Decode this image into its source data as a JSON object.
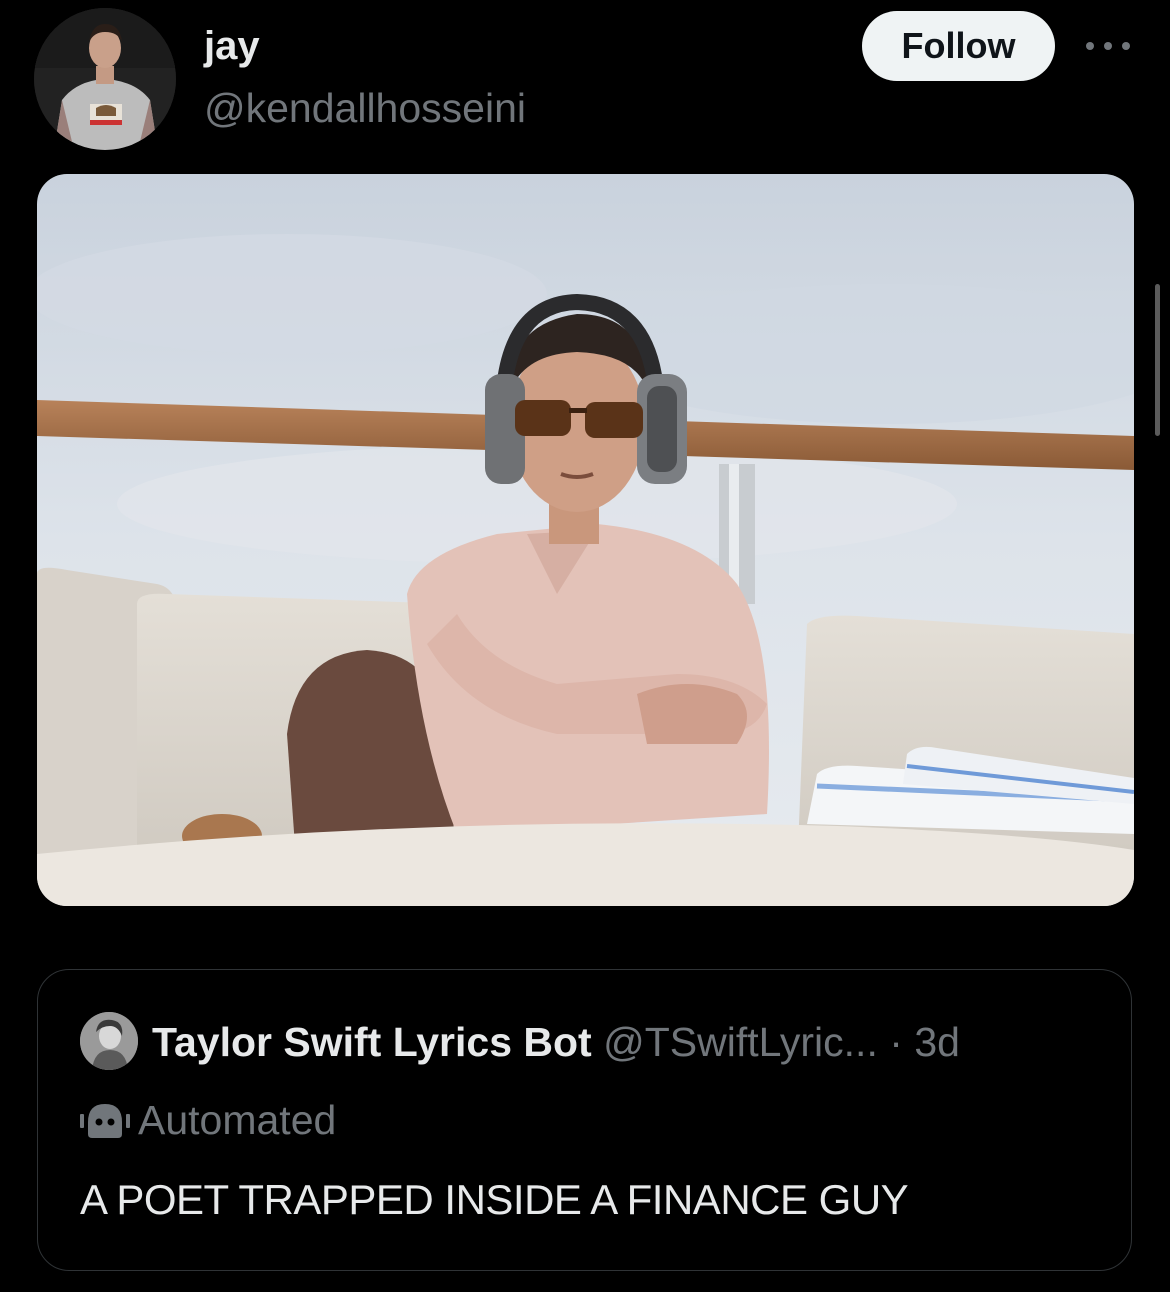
{
  "post": {
    "author": {
      "display_name": "jay",
      "handle": "@kendallhosseini"
    },
    "follow_label": "Follow",
    "more_icon": "more-horizontal-icon"
  },
  "quoted_post": {
    "author_name": "Taylor Swift Lyrics Bot",
    "author_handle": "@TSwiftLyric...",
    "separator": "·",
    "time": "3d",
    "automated_label": "Automated",
    "automated_icon": "bot-icon",
    "text": "A POET TRAPPED INSIDE A FINANCE GUY"
  },
  "colors": {
    "background": "#000000",
    "primary_text": "#e7e9ea",
    "secondary_text": "#71767b",
    "border": "#2f3336",
    "follow_button_bg": "#eff3f4"
  }
}
